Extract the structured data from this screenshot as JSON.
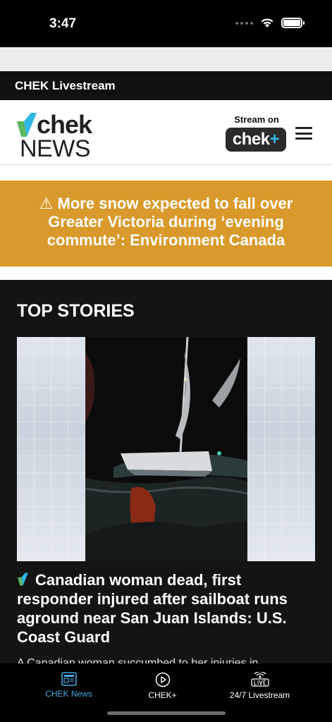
{
  "status_bar": {
    "time": "3:47"
  },
  "livestream_bar": {
    "label": "CHEK Livestream"
  },
  "header": {
    "logo_top": "chek",
    "logo_bottom": "NEWS",
    "stream_on_label": "Stream on",
    "chekplus_text": "chek",
    "chekplus_plus": "+"
  },
  "banner": {
    "text": "⚠ More snow expected to fall over Greater Victoria during ‘evening commute’: Environment Canada"
  },
  "top_stories": {
    "title": "TOP STORIES",
    "story": {
      "headline": "Canadian woman dead, first responder injured after sailboat runs aground near San Juan Islands: U.S. Coast Guard",
      "excerpt": "A Canadian woman succumbed to her injuries in"
    }
  },
  "bottom_nav": {
    "items": [
      {
        "label": "CHEK News",
        "icon": "news-icon",
        "active": true
      },
      {
        "label": "CHEK+",
        "icon": "play-icon",
        "active": false
      },
      {
        "label": "24/7 Livestream",
        "icon": "live-icon",
        "active": false
      }
    ]
  },
  "colors": {
    "banner": "#d99a2b",
    "active_nav": "#47a9e0",
    "brand_green": "#5cb85c",
    "brand_blue": "#2fb7e6"
  }
}
